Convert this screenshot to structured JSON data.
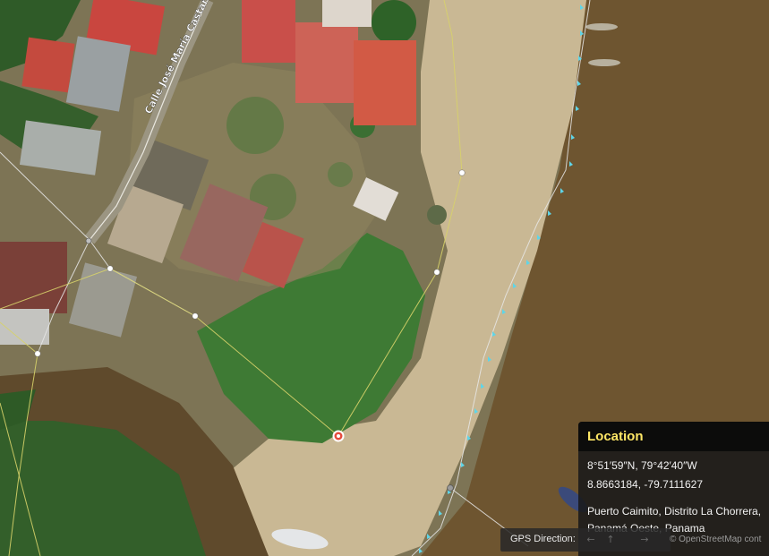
{
  "map": {
    "street_label": "Calle José María Castañ",
    "attribution": "© OpenStreetMap cont"
  },
  "location_panel": {
    "title": "Location",
    "dms": "8°51′59″N, 79°42′40″W",
    "decimal": "8.8663184, -79.7111627",
    "address_line1": "Puerto Caimito, Distrito La Chorrera,",
    "address_line2": "Panamá Oeste, Panama"
  },
  "gps": {
    "label": "GPS Direction:",
    "buttons": [
      "←",
      "↑",
      "→"
    ]
  },
  "colors": {
    "water": "#6e5530",
    "sand": "#c9b894",
    "grass": "#3e7a34",
    "marker": "#e54b3c",
    "path_line": "#d7d26a",
    "panel_title": "#ffe766"
  }
}
